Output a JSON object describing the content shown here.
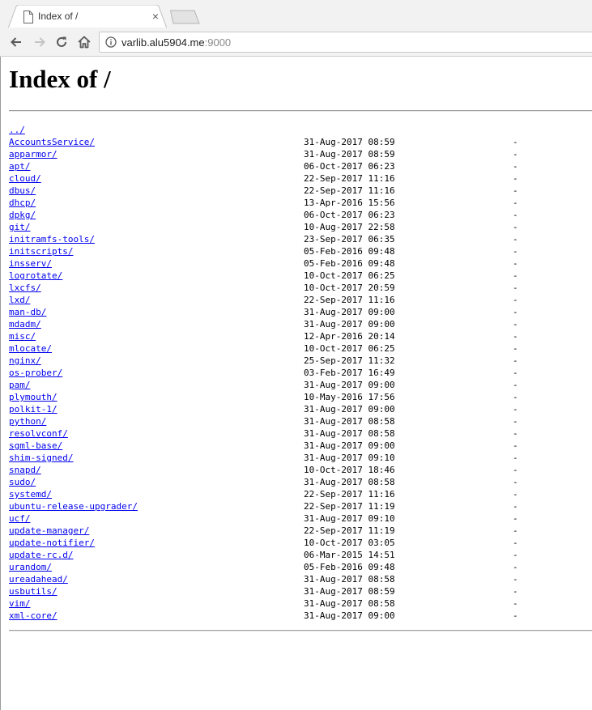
{
  "browser": {
    "tab_title": "Index of /",
    "tab_close": "×",
    "url_host": "varlib.alu5904.me",
    "url_port": ":9000"
  },
  "page": {
    "title": "Index of /",
    "parent_link": "../",
    "entries": [
      {
        "name": "AccountsService/",
        "date": "31-Aug-2017 08:59",
        "size": "-"
      },
      {
        "name": "apparmor/",
        "date": "31-Aug-2017 08:59",
        "size": "-"
      },
      {
        "name": "apt/",
        "date": "06-Oct-2017 06:23",
        "size": "-"
      },
      {
        "name": "cloud/",
        "date": "22-Sep-2017 11:16",
        "size": "-"
      },
      {
        "name": "dbus/",
        "date": "22-Sep-2017 11:16",
        "size": "-"
      },
      {
        "name": "dhcp/",
        "date": "13-Apr-2016 15:56",
        "size": "-"
      },
      {
        "name": "dpkg/",
        "date": "06-Oct-2017 06:23",
        "size": "-"
      },
      {
        "name": "git/",
        "date": "10-Aug-2017 22:58",
        "size": "-"
      },
      {
        "name": "initramfs-tools/",
        "date": "23-Sep-2017 06:35",
        "size": "-"
      },
      {
        "name": "initscripts/",
        "date": "05-Feb-2016 09:48",
        "size": "-"
      },
      {
        "name": "insserv/",
        "date": "05-Feb-2016 09:48",
        "size": "-"
      },
      {
        "name": "logrotate/",
        "date": "10-Oct-2017 06:25",
        "size": "-"
      },
      {
        "name": "lxcfs/",
        "date": "10-Oct-2017 20:59",
        "size": "-"
      },
      {
        "name": "lxd/",
        "date": "22-Sep-2017 11:16",
        "size": "-"
      },
      {
        "name": "man-db/",
        "date": "31-Aug-2017 09:00",
        "size": "-"
      },
      {
        "name": "mdadm/",
        "date": "31-Aug-2017 09:00",
        "size": "-"
      },
      {
        "name": "misc/",
        "date": "12-Apr-2016 20:14",
        "size": "-"
      },
      {
        "name": "mlocate/",
        "date": "10-Oct-2017 06:25",
        "size": "-"
      },
      {
        "name": "nginx/",
        "date": "25-Sep-2017 11:32",
        "size": "-"
      },
      {
        "name": "os-prober/",
        "date": "03-Feb-2017 16:49",
        "size": "-"
      },
      {
        "name": "pam/",
        "date": "31-Aug-2017 09:00",
        "size": "-"
      },
      {
        "name": "plymouth/",
        "date": "10-May-2016 17:56",
        "size": "-"
      },
      {
        "name": "polkit-1/",
        "date": "31-Aug-2017 09:00",
        "size": "-"
      },
      {
        "name": "python/",
        "date": "31-Aug-2017 08:58",
        "size": "-"
      },
      {
        "name": "resolvconf/",
        "date": "31-Aug-2017 08:58",
        "size": "-"
      },
      {
        "name": "sgml-base/",
        "date": "31-Aug-2017 09:00",
        "size": "-"
      },
      {
        "name": "shim-signed/",
        "date": "31-Aug-2017 09:10",
        "size": "-"
      },
      {
        "name": "snapd/",
        "date": "10-Oct-2017 18:46",
        "size": "-"
      },
      {
        "name": "sudo/",
        "date": "31-Aug-2017 08:58",
        "size": "-"
      },
      {
        "name": "systemd/",
        "date": "22-Sep-2017 11:16",
        "size": "-"
      },
      {
        "name": "ubuntu-release-upgrader/",
        "date": "22-Sep-2017 11:19",
        "size": "-"
      },
      {
        "name": "ucf/",
        "date": "31-Aug-2017 09:10",
        "size": "-"
      },
      {
        "name": "update-manager/",
        "date": "22-Sep-2017 11:19",
        "size": "-"
      },
      {
        "name": "update-notifier/",
        "date": "10-Oct-2017 03:05",
        "size": "-"
      },
      {
        "name": "update-rc.d/",
        "date": "06-Mar-2015 14:51",
        "size": "-"
      },
      {
        "name": "urandom/",
        "date": "05-Feb-2016 09:48",
        "size": "-"
      },
      {
        "name": "ureadahead/",
        "date": "31-Aug-2017 08:58",
        "size": "-"
      },
      {
        "name": "usbutils/",
        "date": "31-Aug-2017 08:59",
        "size": "-"
      },
      {
        "name": "vim/",
        "date": "31-Aug-2017 08:58",
        "size": "-"
      },
      {
        "name": "xml-core/",
        "date": "31-Aug-2017 09:00",
        "size": "-"
      }
    ]
  },
  "icons": {
    "tab": "document-icon",
    "back": "back-arrow-icon",
    "forward": "forward-arrow-icon",
    "reload": "reload-icon",
    "home": "home-icon",
    "site_info": "info-icon"
  },
  "colors": {
    "link": "#0000ee",
    "chrome": "#f2f2f2",
    "rule": "#a0a0a0"
  }
}
